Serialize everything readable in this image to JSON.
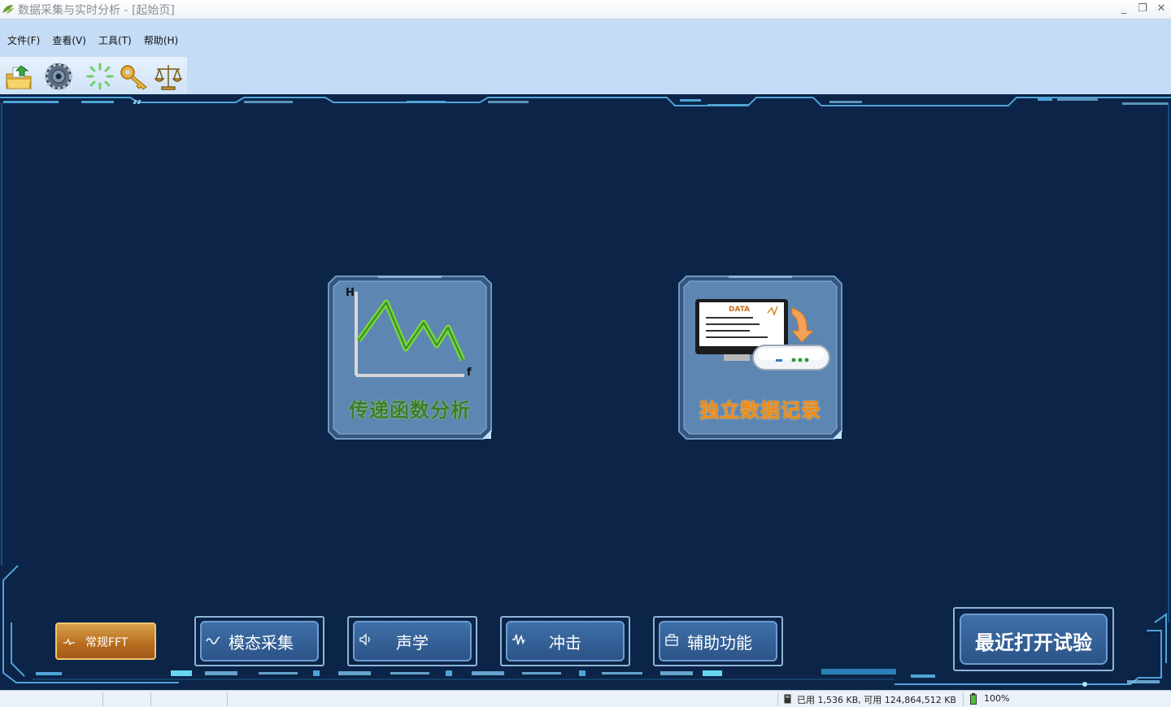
{
  "window": {
    "title": "数据采集与实时分析 - [起始页]",
    "minimize_glyph": "_",
    "restore_glyph": "❐",
    "close_glyph": "✕"
  },
  "menu": [
    {
      "label": "文件(F)"
    },
    {
      "label": "查看(V)"
    },
    {
      "label": "工具(T)"
    },
    {
      "label": "帮助(H)"
    }
  ],
  "toolbar": [
    {
      "icon": "open-folder-icon"
    },
    {
      "icon": "settings-gear-icon"
    },
    {
      "icon": "loading-spinner-icon"
    },
    {
      "icon": "key-icon"
    },
    {
      "icon": "balance-scale-icon"
    }
  ],
  "tiles": [
    {
      "label": "传递函数分析",
      "label_color": "#3f7d2a",
      "chart_axis_y": "H",
      "chart_axis_x": "f"
    },
    {
      "label": "独立数据记录",
      "label_color": "#f08a14",
      "screen_text": "DATA"
    }
  ],
  "bottom_buttons": {
    "fft": "常规FFT",
    "modal": "模态采集",
    "acoustic": "声学",
    "impact": "冲击",
    "aux": "辅助功能",
    "recent": "最近打开试验"
  },
  "status": {
    "memory": "已用 1,536 KB, 可用 124,864,512 KB",
    "battery": "100%"
  },
  "colors": {
    "background": "#0b2447",
    "accent": "#4fa3d8",
    "tile_face": "#5d86b2",
    "button_blue": "#34629a",
    "fft_orange": "#c07a28"
  }
}
